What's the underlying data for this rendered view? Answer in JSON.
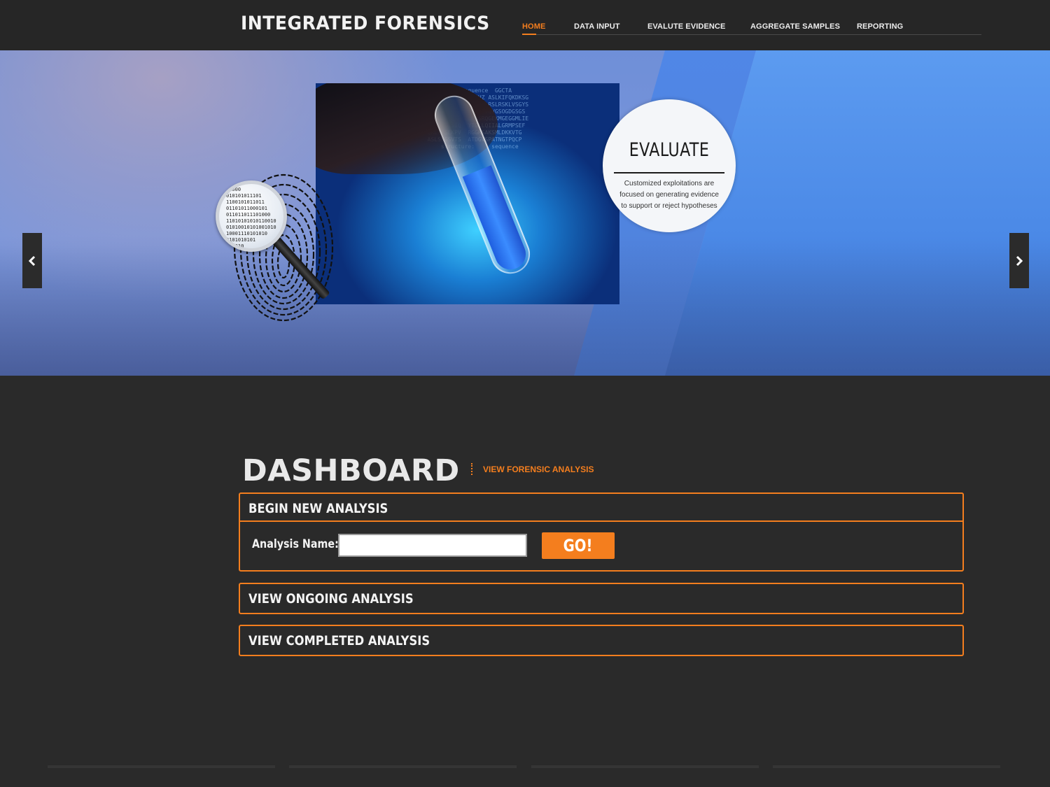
{
  "header": {
    "logo": "INTEGRATED FORENSICS",
    "nav": [
      {
        "label": "HOME",
        "active": true
      },
      {
        "label": "DATA INPUT",
        "active": false
      },
      {
        "label": "EVALUTE EVIDENCE",
        "active": false
      },
      {
        "label": "AGGREGATE SAMPLES",
        "active": false
      },
      {
        "label": "REPORTING",
        "active": false
      }
    ]
  },
  "hero": {
    "slide_title": "EVALUATE",
    "slide_text": "Customized exploitations are focused on generating evidence to support or reject hypotheses",
    "prev_icon": "chevron-left-icon",
    "next_icon": "chevron-right-icon",
    "magnifier_bits": "11000\n010101011101\n1100101011011\n01101011000101\n011011011101000\n11010101010110010\n01010010101001010\n10001110101010\n0101010101\n 11010",
    "photo_text": "  +Y   DNA  sequence  GGCTA\n  RXDGFSHSSIQZRCSHZ ASLKIFQKDKSG\n  GSCDHBLEQDDISVDG  RSLRSKLVSGYS\n  QDWFRSERAR DKFATTVQVGSOGDGSGS\n  VSAQTTAYEL ELESSRQGEKMGEGGMLIE\n  SPYFCTISIQ  YTGLLQIIALGRMPSEF\n  QRLVFSEKPV  RGGKSAKSMLDKKVTG\n  ASLSSGSVTS  ATDGVSPATNGTPQCP\n      structure:     sequence",
    "colors": {
      "accent": "#f47e1e",
      "header_bg": "#262626",
      "page_bg": "#2a2a2a"
    }
  },
  "dashboard": {
    "title": "DASHBOARD",
    "link": "VIEW FORENSIC ANALYSIS",
    "begin": {
      "title": "BEGIN NEW ANALYSIS",
      "field_label": "Analysis Name:",
      "field_value": "",
      "field_placeholder": "",
      "button": "GO!"
    },
    "ongoing_title": "VIEW ONGOING ANALYSIS",
    "completed_title": "VIEW COMPLETED ANALYSIS"
  }
}
